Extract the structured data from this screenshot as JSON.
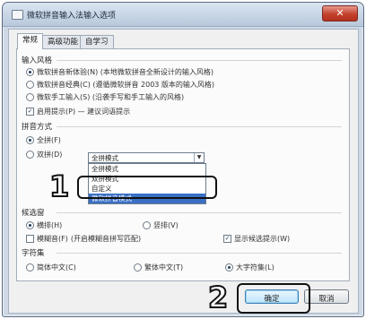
{
  "window": {
    "title": "微软拼音输入法输入选项",
    "close_glyph": "✕"
  },
  "tabs": [
    {
      "label": "常规"
    },
    {
      "label": "高级功能"
    },
    {
      "label": "自学习"
    }
  ],
  "input_style": {
    "header": "输入风格",
    "options": [
      {
        "label": "微软拼音新体验(N)  (本地微软拼音全新设计的输入风格)",
        "checked": true
      },
      {
        "label": "微软拼音经典(C)  (遵循微软拼音 2003 版本的输入风格)",
        "checked": false
      },
      {
        "label": "微软手工输入(S)  (沿袭手写和手工输入的风格)",
        "checked": false
      }
    ],
    "checkbox": {
      "label": "启用提示(P) — 建议词语提示",
      "checked": true
    }
  },
  "pinyin_method": {
    "header": "拼音方式",
    "full_pinyin_label": "全拼(F)",
    "shuangpin_label": "双拼(D)",
    "select_value": "全拼模式",
    "dropdown_options": [
      "全拼模式",
      "双拼模式",
      "自定义",
      "微软拼音模式"
    ],
    "selected_index": 3
  },
  "candidates": {
    "header": "候选窗",
    "horizontal_label": "横排(H)",
    "vertical_label": "竖排(V)",
    "fuzzy_label": "模糊音(F)",
    "fuzzy_hint": "(开启模糊音拼写匹配)",
    "show_hint_label": "显示候选提示(W)"
  },
  "charset": {
    "header": "字符集",
    "simplified_label": "简体中文(C)",
    "traditional_label": "繁体中文(T)",
    "large_label": "大字符集(L)"
  },
  "buttons": {
    "ok": "确定",
    "cancel": "取消"
  },
  "annotations": {
    "step1": "1",
    "step2": "2"
  }
}
